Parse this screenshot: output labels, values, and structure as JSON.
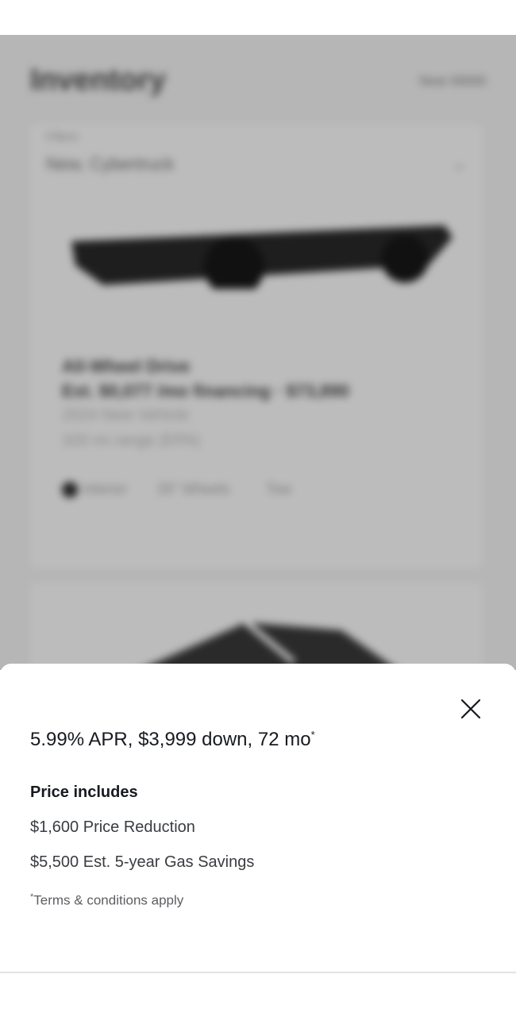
{
  "background": {
    "page_title": "Inventory",
    "location": "Near 00000",
    "filter_label": "Filters",
    "filter_value": "New, Cybertruck",
    "vehicle": {
      "trim": "All-Wheel Drive",
      "price_line": "Est. $0,077 /mo financing · $73,890",
      "condition": "2024 New Vehicle",
      "range": "320 mi range (EPA)",
      "options": [
        "Interior",
        "20\" Wheels",
        "Tow"
      ]
    }
  },
  "sheet": {
    "offer_title": "5.99% APR, $3,999 down, 72 mo",
    "offer_marker": "*",
    "price_includes_heading": "Price includes",
    "items": [
      "$1,600 Price Reduction",
      "$5,500 Est. 5-year Gas Savings"
    ],
    "terms_marker": "*",
    "terms_text": "Terms & conditions apply"
  },
  "icons": {
    "close": "close-icon"
  }
}
